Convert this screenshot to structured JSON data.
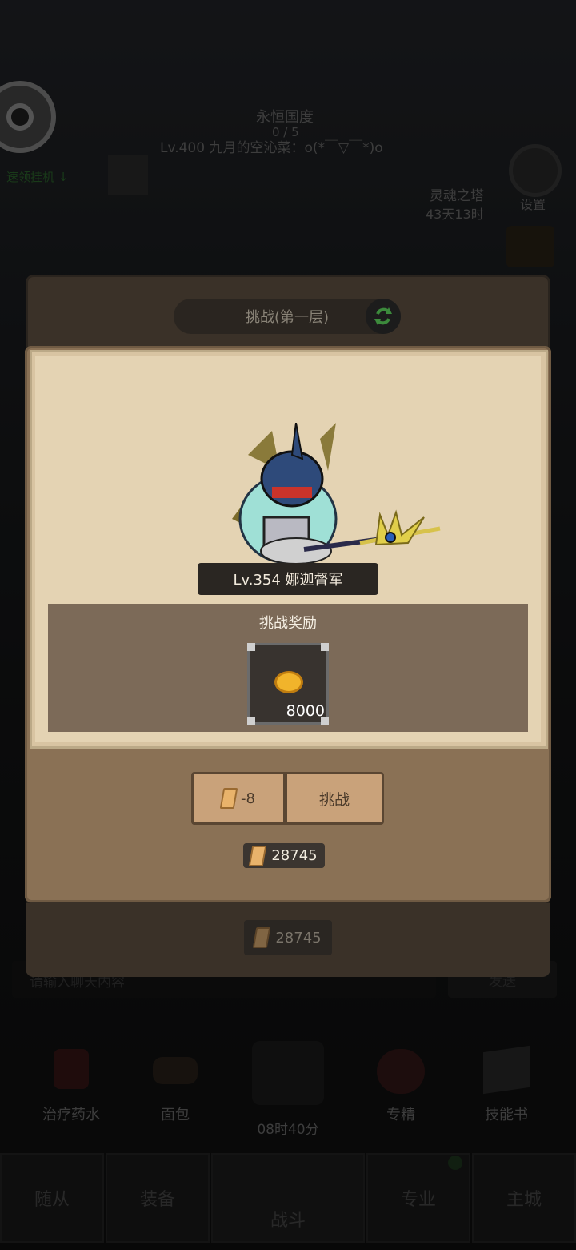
{
  "background": {
    "region_name": "永恒国度",
    "region_count": "0 / 5",
    "player_line": "Lv.400 九月的空沁菜：o(*￣▽￣*)o",
    "left_label": "速领挂机 ↓",
    "event_name": "灵魂之塔",
    "event_time": "43天13时",
    "settings_label": "设置",
    "chat_placeholder": "请输入聊天内容",
    "chat_send": "发送",
    "items": [
      {
        "label": "治疗药水"
      },
      {
        "label": "面包"
      },
      {
        "label": "08时40分"
      },
      {
        "label": "专精"
      },
      {
        "label": "技能书"
      }
    ],
    "tabs": [
      {
        "label": "随从"
      },
      {
        "label": "装备"
      },
      {
        "label": "战斗"
      },
      {
        "label": "专业"
      },
      {
        "label": "主城"
      }
    ]
  },
  "dialog": {
    "title": "挑战(第一层)",
    "monster_name": "Lv.354 娜迦督军",
    "reward_title": "挑战奖励",
    "reward_amount": "8000",
    "cost_label": "-8",
    "challenge_label": "挑战",
    "balance": "28745",
    "balance_behind": "28745"
  }
}
